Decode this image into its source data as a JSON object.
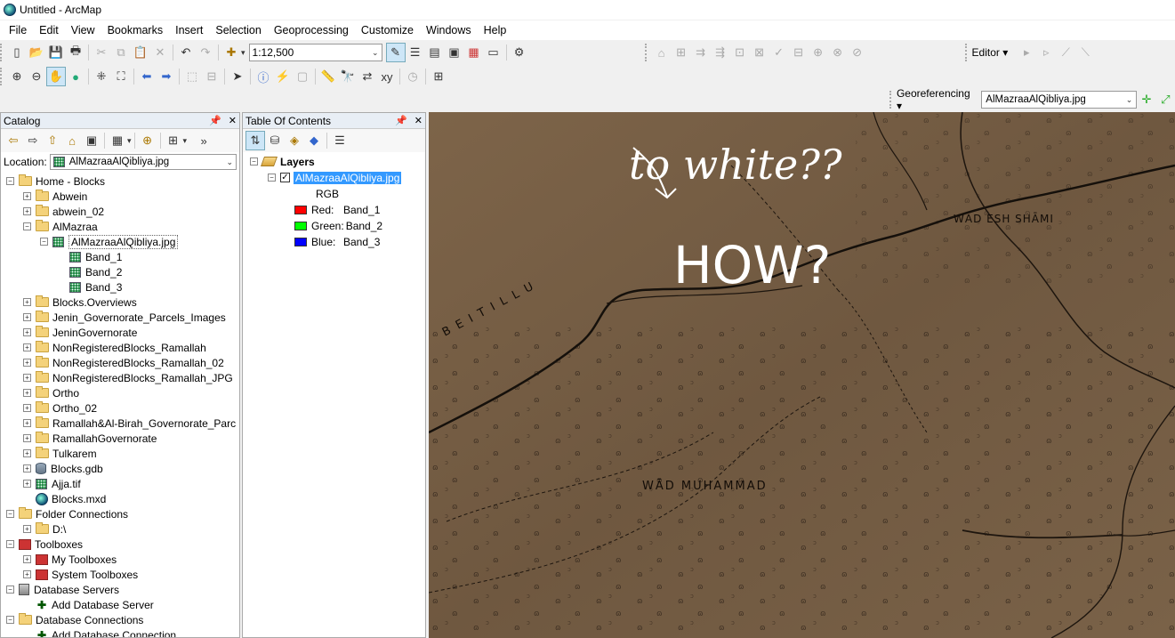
{
  "window": {
    "title": "Untitled - ArcMap"
  },
  "menu": [
    "File",
    "Edit",
    "View",
    "Bookmarks",
    "Insert",
    "Selection",
    "Geoprocessing",
    "Customize",
    "Windows",
    "Help"
  ],
  "toolbar": {
    "scale": "1:12,500",
    "editor_label": "Editor ▾"
  },
  "georeferencing": {
    "label": "Georeferencing ▾",
    "layer": "AlMazraaAlQibliya.jpg"
  },
  "catalog": {
    "title": "Catalog",
    "location_label": "Location:",
    "location_value": "AlMazraaAlQibliya.jpg",
    "items": [
      {
        "label": "Home - Blocks",
        "icon": "folder-icon",
        "level": 0,
        "toggle": "minus"
      },
      {
        "label": "Abwein",
        "icon": "folder-icon",
        "level": 1,
        "toggle": "plus"
      },
      {
        "label": "abwein_02",
        "icon": "folder-icon",
        "level": 1,
        "toggle": "plus"
      },
      {
        "label": "AlMazraa",
        "icon": "folder-icon",
        "level": 1,
        "toggle": "minus"
      },
      {
        "label": "AlMazraaAlQibliya.jpg",
        "icon": "raster-icon",
        "level": 2,
        "toggle": "minus",
        "selected": true
      },
      {
        "label": "Band_1",
        "icon": "raster-icon",
        "level": 3,
        "toggle": ""
      },
      {
        "label": "Band_2",
        "icon": "raster-icon",
        "level": 3,
        "toggle": ""
      },
      {
        "label": "Band_3",
        "icon": "raster-icon",
        "level": 3,
        "toggle": ""
      },
      {
        "label": "Blocks.Overviews",
        "icon": "folder-icon",
        "level": 1,
        "toggle": "plus"
      },
      {
        "label": "Jenin_Governorate_Parcels_Images",
        "icon": "folder-icon",
        "level": 1,
        "toggle": "plus"
      },
      {
        "label": "JeninGovernorate",
        "icon": "folder-icon",
        "level": 1,
        "toggle": "plus"
      },
      {
        "label": "NonRegisteredBlocks_Ramallah",
        "icon": "folder-icon",
        "level": 1,
        "toggle": "plus"
      },
      {
        "label": "NonRegisteredBlocks_Ramallah_02",
        "icon": "folder-icon",
        "level": 1,
        "toggle": "plus"
      },
      {
        "label": "NonRegisteredBlocks_Ramallah_JPG",
        "icon": "folder-icon",
        "level": 1,
        "toggle": "plus"
      },
      {
        "label": "Ortho",
        "icon": "folder-icon",
        "level": 1,
        "toggle": "plus"
      },
      {
        "label": "Ortho_02",
        "icon": "folder-icon",
        "level": 1,
        "toggle": "plus"
      },
      {
        "label": "Ramallah&Al-Birah_Governorate_Parc",
        "icon": "folder-icon",
        "level": 1,
        "toggle": "plus"
      },
      {
        "label": "RamallahGovernorate",
        "icon": "folder-icon",
        "level": 1,
        "toggle": "plus"
      },
      {
        "label": "Tulkarem",
        "icon": "folder-icon",
        "level": 1,
        "toggle": "plus"
      },
      {
        "label": "Blocks.gdb",
        "icon": "geodatabase-icon",
        "level": 1,
        "toggle": "plus"
      },
      {
        "label": "Ajja.tif",
        "icon": "raster-icon",
        "level": 1,
        "toggle": "plus"
      },
      {
        "label": "Blocks.mxd",
        "icon": "map-document-icon",
        "level": 1,
        "toggle": ""
      },
      {
        "label": "Folder Connections",
        "icon": "folder-icon",
        "level": 0,
        "toggle": "minus"
      },
      {
        "label": "D:\\",
        "icon": "folder-icon",
        "level": 1,
        "toggle": "plus"
      },
      {
        "label": "Toolboxes",
        "icon": "toolbox-icon",
        "level": 0,
        "toggle": "minus"
      },
      {
        "label": "My Toolboxes",
        "icon": "toolbox-icon",
        "level": 1,
        "toggle": "plus"
      },
      {
        "label": "System Toolboxes",
        "icon": "toolbox-icon",
        "level": 1,
        "toggle": "plus"
      },
      {
        "label": "Database Servers",
        "icon": "database-server-icon",
        "level": 0,
        "toggle": "minus"
      },
      {
        "label": "Add Database Server",
        "icon": "add-icon",
        "level": 1,
        "toggle": ""
      },
      {
        "label": "Database Connections",
        "icon": "folder-icon",
        "level": 0,
        "toggle": "minus"
      },
      {
        "label": "Add Database Connection",
        "icon": "add-icon",
        "level": 1,
        "toggle": ""
      }
    ]
  },
  "toc": {
    "title": "Table Of Contents",
    "layers_label": "Layers",
    "layer_name": "AlMazraaAlQibliya.jpg",
    "rgb_label": "RGB",
    "bands": [
      {
        "channel": "Red:",
        "band": "Band_1",
        "color": "#ff0000"
      },
      {
        "channel": "Green:",
        "band": "Band_2",
        "color": "#00ff00"
      },
      {
        "channel": "Blue:",
        "band": "Band_3",
        "color": "#0000ff"
      }
    ]
  },
  "map": {
    "annotation_1": "to white??",
    "annotation_2": "HOW?",
    "labels": {
      "wad_esh_shami": "WĀD ESH SHĀMI",
      "beitillu": "B E I T I L L U",
      "wad_muhammad": "WĀD MUHAMMAD"
    },
    "background_color": "#735c44"
  }
}
